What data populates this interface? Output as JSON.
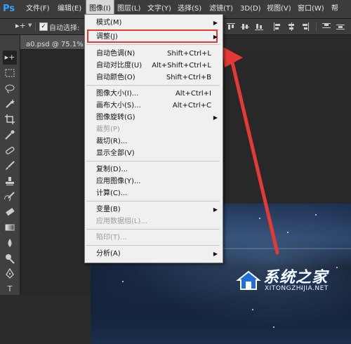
{
  "app": {
    "logo": "Ps",
    "menu": [
      "文件(F)",
      "编辑(E)",
      "图像(I)",
      "图层(L)",
      "文字(Y)",
      "选择(S)",
      "滤镜(T)",
      "3D(D)",
      "视图(V)",
      "窗口(W)",
      "帮"
    ],
    "active_menu_index": 2
  },
  "options_bar": {
    "tool_icon": "move-tool-icon",
    "auto_select_label": "自动选择:",
    "auto_select_checked": true
  },
  "document": {
    "tab_title": "a0.psd @ 75.1% (背"
  },
  "toolbar": {
    "tools": [
      "move-tool",
      "marquee-tool",
      "lasso-tool",
      "magic-wand-tool",
      "crop-tool",
      "eyedropper-tool",
      "healing-brush-tool",
      "brush-tool",
      "clone-stamp-tool",
      "history-brush-tool",
      "eraser-tool",
      "gradient-tool",
      "blur-tool",
      "dodge-tool",
      "pen-tool",
      "type-tool",
      "path-selection-tool"
    ]
  },
  "image_menu": {
    "items": [
      {
        "label": "模式(M)",
        "shortcut": "",
        "submenu": true,
        "disabled": false
      },
      {
        "label": "调整(J)",
        "shortcut": "",
        "submenu": true,
        "disabled": false,
        "highlighted": true
      },
      {
        "label": "自动色调(N)",
        "shortcut": "Shift+Ctrl+L",
        "submenu": false,
        "disabled": false
      },
      {
        "label": "自动对比度(U)",
        "shortcut": "Alt+Shift+Ctrl+L",
        "submenu": false,
        "disabled": false
      },
      {
        "label": "自动颜色(O)",
        "shortcut": "Shift+Ctrl+B",
        "submenu": false,
        "disabled": false
      },
      {
        "label": "图像大小(I)...",
        "shortcut": "Alt+Ctrl+I",
        "submenu": false,
        "disabled": false
      },
      {
        "label": "画布大小(S)...",
        "shortcut": "Alt+Ctrl+C",
        "submenu": false,
        "disabled": false
      },
      {
        "label": "图像旋转(G)",
        "shortcut": "",
        "submenu": true,
        "disabled": false
      },
      {
        "label": "裁剪(P)",
        "shortcut": "",
        "submenu": false,
        "disabled": true
      },
      {
        "label": "裁切(R)...",
        "shortcut": "",
        "submenu": false,
        "disabled": false
      },
      {
        "label": "显示全部(V)",
        "shortcut": "",
        "submenu": false,
        "disabled": false
      },
      {
        "label": "复制(D)...",
        "shortcut": "",
        "submenu": false,
        "disabled": false
      },
      {
        "label": "应用图像(Y)...",
        "shortcut": "",
        "submenu": false,
        "disabled": false
      },
      {
        "label": "计算(C)...",
        "shortcut": "",
        "submenu": false,
        "disabled": false
      },
      {
        "label": "变量(B)",
        "shortcut": "",
        "submenu": true,
        "disabled": false
      },
      {
        "label": "应用数据组(L)...",
        "shortcut": "",
        "submenu": false,
        "disabled": true
      },
      {
        "label": "陷印(T)...",
        "shortcut": "",
        "submenu": false,
        "disabled": true
      },
      {
        "label": "分析(A)",
        "shortcut": "",
        "submenu": true,
        "disabled": false
      }
    ]
  },
  "watermark": {
    "brand": "系统之家",
    "url": "XITONGZHIJIA.NET"
  },
  "colors": {
    "highlight_border": "#e53935",
    "annotation_arrow": "#e53935"
  }
}
